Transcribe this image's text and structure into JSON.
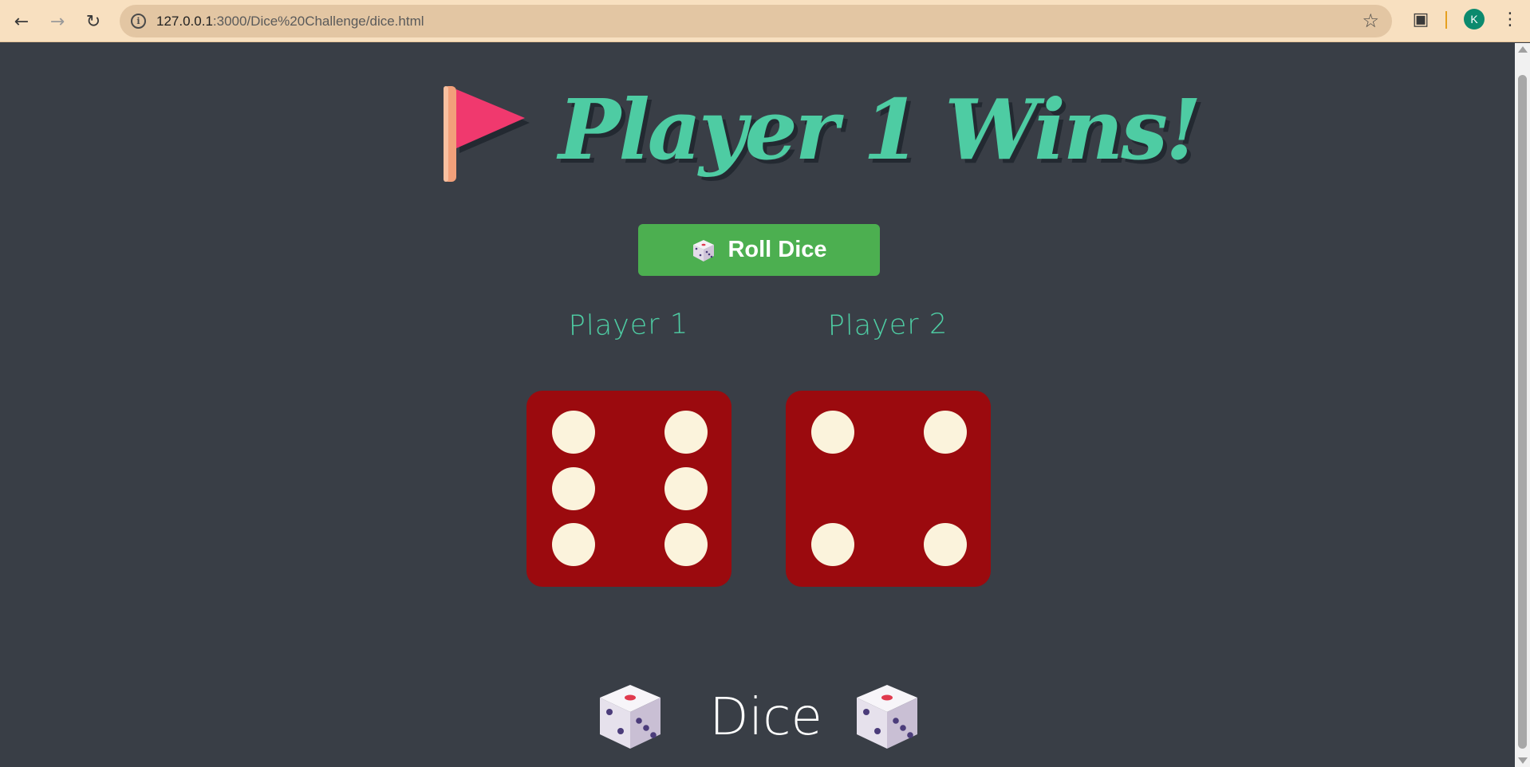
{
  "browser": {
    "url_host": "127.0.0.1",
    "url_path": ":3000/Dice%20Challenge/dice.html",
    "profile_initial": "K"
  },
  "page": {
    "title": "Player 1 Wins!",
    "roll_button_label": "Roll Dice",
    "players": [
      {
        "label": "Player 1",
        "die_value": 6
      },
      {
        "label": "Player 2",
        "die_value": 4
      }
    ],
    "footer_title": "Dice"
  },
  "colors": {
    "background": "#393e46",
    "accent": "#4ecca3",
    "button": "#4caf50",
    "die": "#9b0a0e",
    "pip": "#fbf3dc"
  },
  "icons": {
    "title": "triangular-flag-icon",
    "button": "game-die-icon",
    "footer": "game-die-icon"
  }
}
